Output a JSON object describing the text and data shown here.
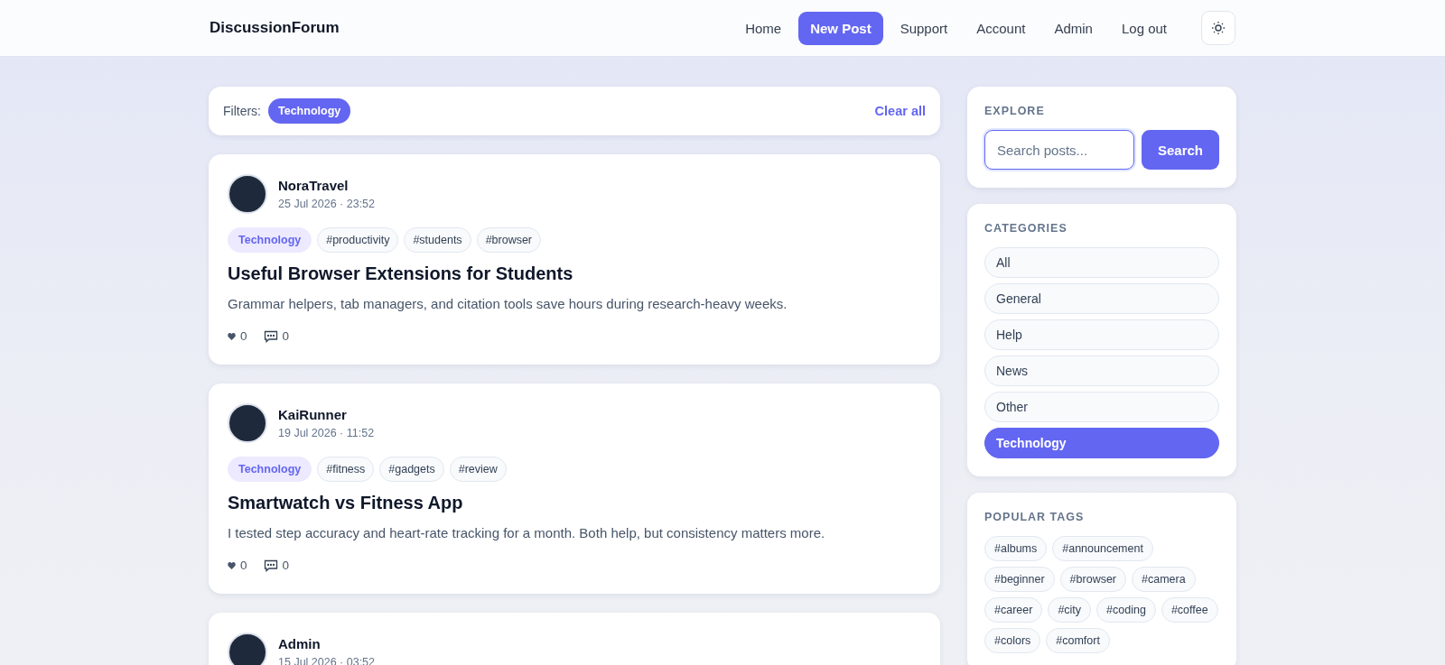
{
  "header": {
    "logo": "DiscussionForum",
    "nav": [
      {
        "label": "Home",
        "kind": "link"
      },
      {
        "label": "New Post",
        "kind": "primary"
      },
      {
        "label": "Support",
        "kind": "link"
      },
      {
        "label": "Account",
        "kind": "link"
      },
      {
        "label": "Admin",
        "kind": "link"
      },
      {
        "label": "Log out",
        "kind": "link"
      }
    ]
  },
  "filters": {
    "label": "Filters:",
    "chips": [
      "Technology"
    ],
    "clear": "Clear all"
  },
  "posts": [
    {
      "author": "NoraTravel",
      "date": "25 Jul 2026 · 23:52",
      "category": "Technology",
      "tags": [
        "#productivity",
        "#students",
        "#browser"
      ],
      "title": "Useful Browser Extensions for Students",
      "body": "Grammar helpers, tab managers, and citation tools save hours during research-heavy weeks.",
      "likes": "0",
      "comments": "0"
    },
    {
      "author": "KaiRunner",
      "date": "19 Jul 2026 · 11:52",
      "category": "Technology",
      "tags": [
        "#fitness",
        "#gadgets",
        "#review"
      ],
      "title": "Smartwatch vs Fitness App",
      "body": "I tested step accuracy and heart-rate tracking for a month. Both help, but consistency matters more.",
      "likes": "0",
      "comments": "0"
    },
    {
      "author": "Admin",
      "date": "15 Jul 2026 · 03:52"
    }
  ],
  "sidebar": {
    "explore": {
      "heading": "EXPLORE",
      "placeholder": "Search posts...",
      "focused": true,
      "button": "Search"
    },
    "categories": {
      "heading": "CATEGORIES",
      "items": [
        {
          "label": "All",
          "selected": false
        },
        {
          "label": "General",
          "selected": false
        },
        {
          "label": "Help",
          "selected": false
        },
        {
          "label": "News",
          "selected": false
        },
        {
          "label": "Other",
          "selected": false
        },
        {
          "label": "Technology",
          "selected": true
        }
      ]
    },
    "tags": {
      "heading": "POPULAR TAGS",
      "items": [
        "#albums",
        "#announcement",
        "#beginner",
        "#browser",
        "#camera",
        "#career",
        "#city",
        "#coding",
        "#coffee",
        "#colors",
        "#comfort"
      ]
    }
  }
}
